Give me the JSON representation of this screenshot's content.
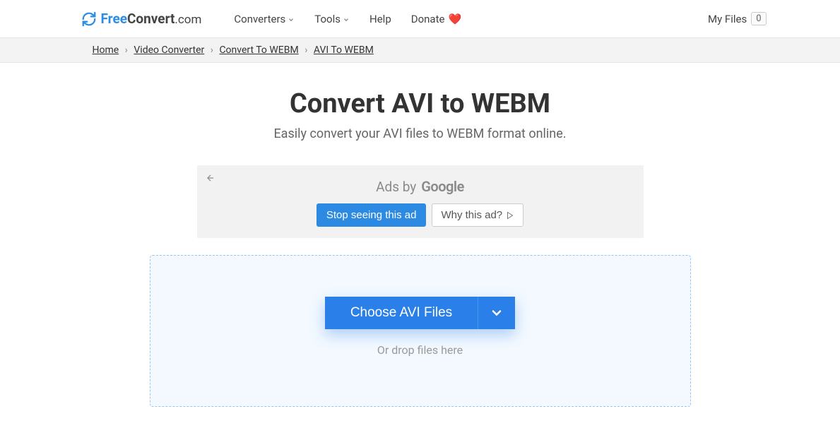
{
  "logo": {
    "free": "Free",
    "convert": "Convert",
    "com": ".com"
  },
  "nav": {
    "converters": "Converters",
    "tools": "Tools",
    "help": "Help",
    "donate": "Donate"
  },
  "myfiles": {
    "label": "My Files",
    "count": "0"
  },
  "breadcrumb": {
    "home": "Home",
    "video_converter": "Video Converter",
    "convert_to_webm": "Convert To WEBM",
    "avi_to_webm": "AVI To WEBM"
  },
  "hero": {
    "title": "Convert AVI to WEBM",
    "subtitle": "Easily convert your AVI files to WEBM format online."
  },
  "ad": {
    "ads_by": "Ads by",
    "stop": "Stop seeing this ad",
    "why": "Why this ad?"
  },
  "dropzone": {
    "choose": "Choose AVI Files",
    "or_drop": "Or drop files here"
  }
}
